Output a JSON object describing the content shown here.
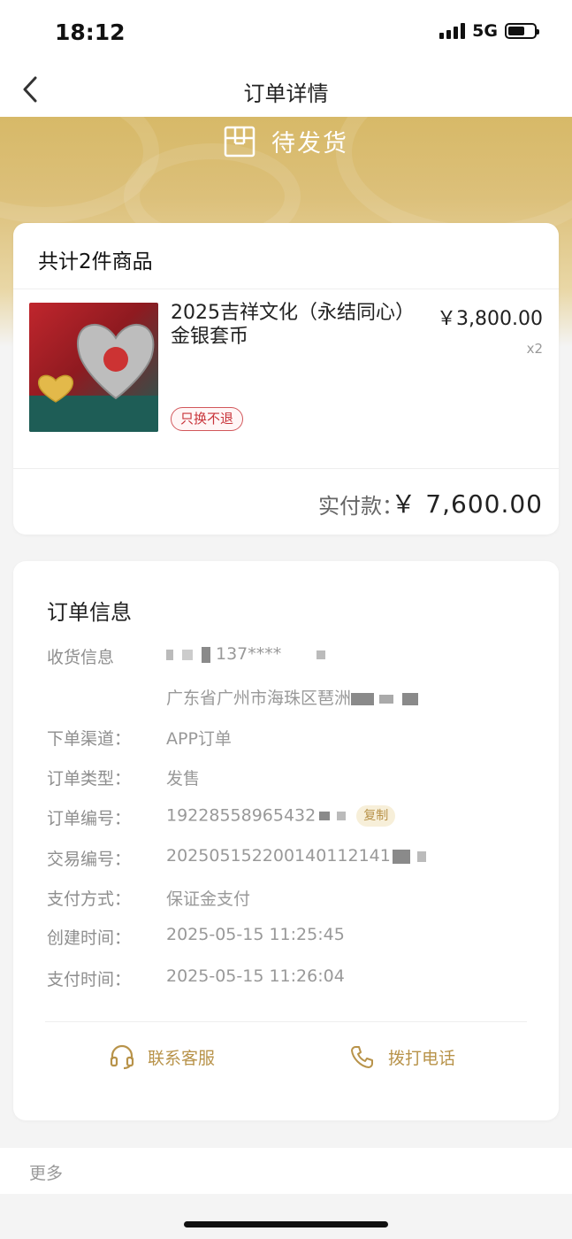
{
  "status_bar": {
    "time": "18:12",
    "network": "5G"
  },
  "nav": {
    "title": "订单详情"
  },
  "order_status": {
    "text": "待发货"
  },
  "goods": {
    "header": "共计2件商品",
    "items": [
      {
        "name": "2025吉祥文化（永结同心）金银套币",
        "price": "￥3,800.00",
        "qty": "x2",
        "tag": "只换不退"
      }
    ],
    "paid_label": "实付款：",
    "paid_value": "￥ 7,600.00"
  },
  "order_info": {
    "title": "订单信息",
    "receiver": {
      "label": "收货信息",
      "phone": "137****",
      "address": "广东省广州市海珠区琶洲"
    },
    "channel": {
      "label": "下单渠道：",
      "value": "APP订单"
    },
    "type": {
      "label": "订单类型：",
      "value": "发售"
    },
    "order_no": {
      "label": "订单编号：",
      "value": "19228558965432",
      "copy": "复制"
    },
    "trade_no": {
      "label": "交易编号：",
      "value": "202505152200140112141"
    },
    "pay_method": {
      "label": "支付方式：",
      "value": "保证金支付"
    },
    "created": {
      "label": "创建时间：",
      "value": "2025-05-15 11:25:45"
    },
    "paid_time": {
      "label": "支付时间：",
      "value": "2025-05-15 11:26:04"
    },
    "actions": {
      "service": "联系客服",
      "call": "拨打电话"
    }
  },
  "more": {
    "label": "更多"
  },
  "colors": {
    "gold": "#b8934a",
    "band": "#d7b968",
    "tag_red": "#c8343a"
  }
}
